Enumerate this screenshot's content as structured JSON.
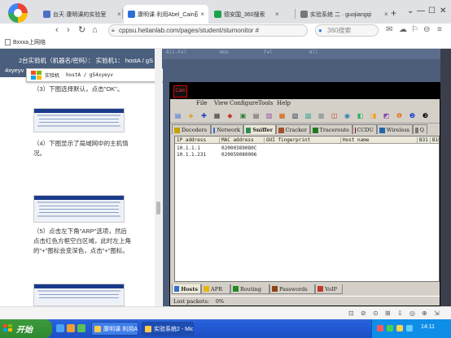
{
  "tabs": [
    {
      "title": "台天·康明课的实验室",
      "favicon": "#4a6fc4",
      "active": false
    },
    {
      "title": "康明课·利用Abel_Cain获取",
      "favicon": "#2d6fd6",
      "active": true
    },
    {
      "title": "德安国_360搜索",
      "favicon": "#1aa34a",
      "active": false
    },
    {
      "title": "实验系统 二 · guojiangqi",
      "favicon": "#777777",
      "active": false
    }
  ],
  "tab_close_glyph": "×",
  "newtab_glyph": "+",
  "window_controls": [
    "⌄",
    "—",
    "☐",
    "✕"
  ],
  "toolbar": {
    "back": "‹",
    "forward": "›",
    "reload": "↻",
    "home": "⌂",
    "url": "cppsu.hetianlab.com/pages/student/stumonitor #",
    "search_placeholder": "360搜索",
    "right_icons": [
      "✉",
      "☁",
      "⚐",
      "⊖",
      "≡"
    ]
  },
  "bookmarks": [
    {
      "label": "Bxxxa上网络"
    }
  ],
  "left_panel": {
    "header_line1": "2台实验机（机器名/密码）：   实验机1：   hostA / gS",
    "header_line2": "4xyeyv",
    "overlay_label": "实验机",
    "overlay_value": "hostA / gS4xyeyv",
    "overlay_arrow": "▼",
    "paragraphs": [
      {
        "text": "（3）下图选择默认，点击\"OK\"。"
      },
      {
        "text": "（4）下图显示了局域网中的主机情况。"
      },
      {
        "text": "（5）点击左下角\"ARP\"选项，然后点击红色方框空白区域，此时左上角的\"+\"图标会变深色，点击\"+\"图标。"
      }
    ]
  },
  "remote": {
    "top_tabs": [
      "Ali-Fel",
      "Web",
      "Fel",
      "All"
    ],
    "app": {
      "logo": "Cain",
      "menu": [
        "File",
        "View",
        "Configure",
        "Tools",
        "Help"
      ],
      "toolbar_icons": [
        {
          "glyph": "▤",
          "color": "#3a6fd8"
        },
        {
          "glyph": "◈",
          "color": "#d4a017"
        },
        {
          "glyph": "✚",
          "color": "#1a3bd1"
        },
        {
          "glyph": "▦",
          "color": "#333333"
        },
        {
          "glyph": "◆",
          "color": "#c0392b"
        },
        {
          "glyph": "▣",
          "color": "#2e7d32"
        },
        {
          "glyph": "▤",
          "color": "#555555"
        },
        {
          "glyph": "▥",
          "color": "#8e44ad"
        },
        {
          "glyph": "▦",
          "color": "#d35400"
        },
        {
          "glyph": "▧",
          "color": "#2c3e50"
        },
        {
          "glyph": "▨",
          "color": "#16a085"
        },
        {
          "glyph": "▩",
          "color": "#7f8c8d"
        },
        {
          "glyph": "◫",
          "color": "#c0392b"
        },
        {
          "glyph": "◉",
          "color": "#2980b9"
        },
        {
          "glyph": "◧",
          "color": "#27ae60"
        },
        {
          "glyph": "◨",
          "color": "#f39c12"
        },
        {
          "glyph": "◩",
          "color": "#8e44ad"
        },
        {
          "glyph": "❶",
          "color": "#e67e22"
        },
        {
          "glyph": "❷",
          "color": "#1a3bd1"
        },
        {
          "glyph": "❸",
          "color": "#000000"
        }
      ],
      "tabs": [
        {
          "label": "Decoders",
          "color": "#c8a000"
        },
        {
          "label": "Network",
          "color": "#2b6fd1"
        },
        {
          "label": "Sniffer",
          "color": "#2e8b57",
          "selected": true
        },
        {
          "label": "Cracker",
          "color": "#a0522d"
        },
        {
          "label": "Traceroute",
          "color": "#1f7a1f"
        },
        {
          "label": "CCDU",
          "color": "#8b0000"
        },
        {
          "label": "Wireless",
          "color": "#2266aa"
        },
        {
          "label": "Q",
          "color": "#777777"
        }
      ],
      "columns": [
        "IP address",
        "MAC address",
        "OUI fingerprint",
        "Host name",
        "B31",
        "B16"
      ],
      "rows": [
        {
          "ip": "10.1.1.1",
          "mac": "02000389080C"
        },
        {
          "ip": "10.1.1.231",
          "mac": "020059080006"
        }
      ],
      "bottom_tabs": [
        {
          "label": "Hosts",
          "color": "#2b6fd1",
          "selected": true
        },
        {
          "label": "APR",
          "color": "#e6b800"
        },
        {
          "label": "Routing",
          "color": "#228b22"
        },
        {
          "label": "Passwords",
          "color": "#8b4513"
        },
        {
          "label": "VoIP",
          "color": "#c0392b"
        }
      ],
      "status_label": "Lost packets:",
      "status_value": "0%"
    }
  },
  "status_icons": [
    "⊡",
    "⊘",
    "⊙",
    "⊞",
    "⇩",
    "◎",
    "⊕",
    "⇲"
  ],
  "taskbar": {
    "start_label": "开始",
    "quick_launch": [
      "#4aa3f0",
      "#f0a030",
      "#58c058"
    ],
    "items": [
      {
        "label": "康明课·利用Abel_",
        "active": false
      },
      {
        "label": "实验系统2 - Micr",
        "active": true
      }
    ],
    "tray_icons": [
      "#ff5a5a",
      "#4ad04a",
      "#ffd24a",
      "#66ccff"
    ],
    "clock": "14:11"
  }
}
